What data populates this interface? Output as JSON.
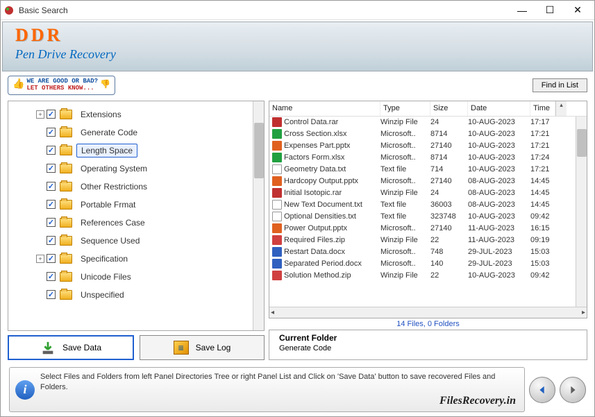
{
  "window": {
    "title": "Basic Search"
  },
  "header": {
    "brand": "DDR",
    "subtitle": "Pen Drive Recovery"
  },
  "toolbar": {
    "feedback_line1": "WE ARE GOOD OR BAD?",
    "feedback_line2": "LET OTHERS KNOW...",
    "find_label": "Find in List"
  },
  "tree": {
    "items": [
      {
        "label": "Extensions",
        "expandable": true
      },
      {
        "label": "Generate Code",
        "expandable": false
      },
      {
        "label": "Length Space",
        "expandable": false,
        "selected": true
      },
      {
        "label": "Operating System",
        "expandable": false
      },
      {
        "label": "Other Restrictions",
        "expandable": false
      },
      {
        "label": "Portable Frmat",
        "expandable": false
      },
      {
        "label": "References Case",
        "expandable": false
      },
      {
        "label": "Sequence Used",
        "expandable": false
      },
      {
        "label": "Specification",
        "expandable": true
      },
      {
        "label": "Unicode Files",
        "expandable": false
      },
      {
        "label": "Unspecified",
        "expandable": false
      }
    ]
  },
  "buttons": {
    "save_data": "Save Data",
    "save_log": "Save Log"
  },
  "list": {
    "headers": {
      "name": "Name",
      "type": "Type",
      "size": "Size",
      "date": "Date",
      "time": "Time"
    },
    "rows": [
      {
        "name": "Control Data.rar",
        "type": "Winzip File",
        "size": "24",
        "date": "10-AUG-2023",
        "time": "17:17",
        "ico": "rar"
      },
      {
        "name": "Cross Section.xlsx",
        "type": "Microsoft..",
        "size": "8714",
        "date": "10-AUG-2023",
        "time": "17:21",
        "ico": "xlsx"
      },
      {
        "name": "Expenses Part.pptx",
        "type": "Microsoft..",
        "size": "27140",
        "date": "10-AUG-2023",
        "time": "17:21",
        "ico": "pptx"
      },
      {
        "name": "Factors Form.xlsx",
        "type": "Microsoft..",
        "size": "8714",
        "date": "10-AUG-2023",
        "time": "17:24",
        "ico": "xlsx"
      },
      {
        "name": "Geometry Data.txt",
        "type": "Text file",
        "size": "714",
        "date": "10-AUG-2023",
        "time": "17:21",
        "ico": "txt"
      },
      {
        "name": "Hardcopy Output.pptx",
        "type": "Microsoft..",
        "size": "27140",
        "date": "08-AUG-2023",
        "time": "14:45",
        "ico": "pptx"
      },
      {
        "name": "Initial Isotopic.rar",
        "type": "Winzip File",
        "size": "24",
        "date": "08-AUG-2023",
        "time": "14:45",
        "ico": "rar"
      },
      {
        "name": "New Text Document.txt",
        "type": "Text file",
        "size": "36003",
        "date": "08-AUG-2023",
        "time": "14:45",
        "ico": "txt"
      },
      {
        "name": "Optional Densities.txt",
        "type": "Text file",
        "size": "323748",
        "date": "10-AUG-2023",
        "time": "09:42",
        "ico": "txt"
      },
      {
        "name": "Power Output.pptx",
        "type": "Microsoft..",
        "size": "27140",
        "date": "11-AUG-2023",
        "time": "16:15",
        "ico": "pptx"
      },
      {
        "name": "Required Files.zip",
        "type": "Winzip File",
        "size": "22",
        "date": "11-AUG-2023",
        "time": "09:19",
        "ico": "zip"
      },
      {
        "name": "Restart Data.docx",
        "type": "Microsoft..",
        "size": "748",
        "date": "29-JUL-2023",
        "time": "15:03",
        "ico": "docx"
      },
      {
        "name": "Separated Period.docx",
        "type": "Microsoft..",
        "size": "140",
        "date": "29-JUL-2023",
        "time": "15:03",
        "ico": "docx"
      },
      {
        "name": "Solution Method.zip",
        "type": "Winzip File",
        "size": "22",
        "date": "10-AUG-2023",
        "time": "09:42",
        "ico": "zip"
      }
    ]
  },
  "summary": "14 Files, 0 Folders",
  "current_folder": {
    "title": "Current Folder",
    "value": "Generate Code"
  },
  "status": {
    "text": "Select Files and Folders from left Panel Directories Tree or right Panel List and Click on 'Save Data' button to save recovered Files and Folders.",
    "brand": "FilesRecovery.in"
  }
}
